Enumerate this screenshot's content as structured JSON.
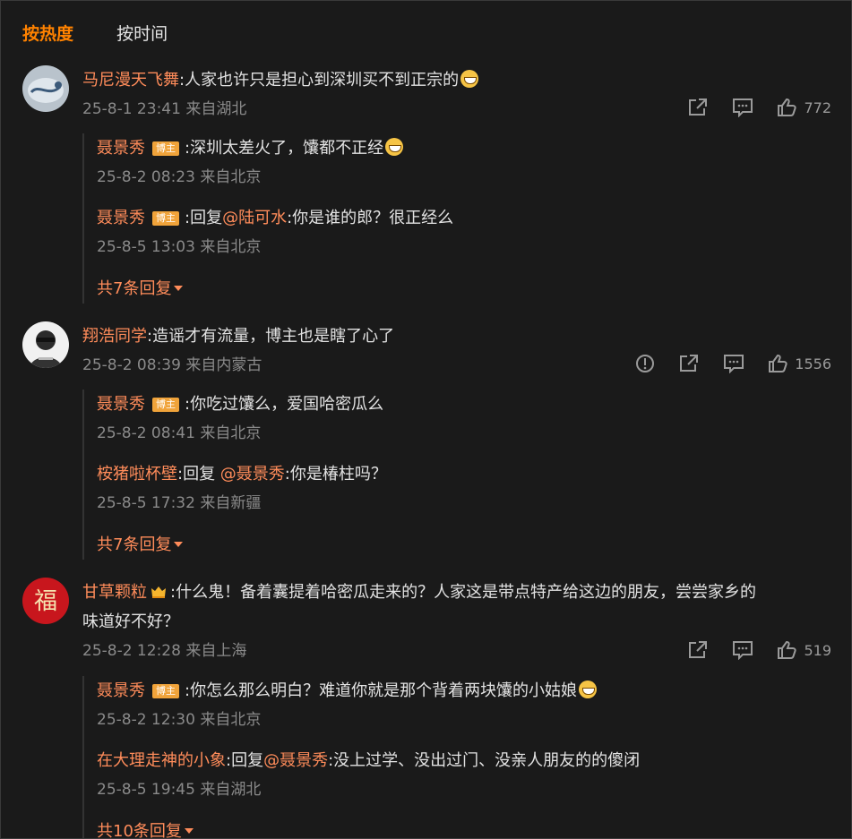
{
  "tabs": {
    "hot": "按热度",
    "time": "按时间"
  },
  "comments": [
    {
      "user": "马尼漫天飞舞",
      "text": ":人家也许只是担心到深圳买不到正宗的",
      "time": "25-8-1 23:41 来自湖北",
      "likes": "772",
      "replies": [
        {
          "user": "聂景秀",
          "badge": "博主",
          "text": ":深圳太差火了，馕都不正经",
          "time": "25-8-2 08:23 来自北京"
        },
        {
          "user": "聂景秀",
          "badge": "博主",
          "prefix": ":回复",
          "mention": "@陆可水",
          "text": ":你是谁的郎？很正经么",
          "time": "25-8-5 13:03 来自北京"
        }
      ],
      "more": "共7条回复"
    },
    {
      "user": "翔浩同学",
      "text": ":造谣才有流量，博主也是瞎了心了",
      "time": "25-8-2 08:39 来自内蒙古",
      "likes": "1556",
      "replies": [
        {
          "user": "聂景秀",
          "badge": "博主",
          "text": ":你吃过馕么，爱国哈密瓜么",
          "time": "25-8-2 08:41 来自北京"
        },
        {
          "user": "桉猪啦杯壁",
          "prefix": ":回复 ",
          "mention": "@聂景秀",
          "text": ":你是椿柱吗？",
          "time": "25-8-5 17:32 来自新疆"
        }
      ],
      "more": "共7条回复"
    },
    {
      "user": "甘草颗粒",
      "text_line1": ":什么鬼！备着囊提着哈密瓜走来的？人家这是带点特产给这边的朋友，尝尝家乡的",
      "text_line2": "味道好不好？",
      "time": "25-8-2 12:28 来自上海",
      "likes": "519",
      "avatar_char": "福",
      "replies": [
        {
          "user": "聂景秀",
          "badge": "博主",
          "text": ":你怎么那么明白？难道你就是那个背着两块馕的小姑娘",
          "time": "25-8-2 12:30 来自北京"
        },
        {
          "user": "在大理走神的小象",
          "prefix": ":回复",
          "mention": "@聂景秀",
          "text": ":没上过学、没出过门、没亲人朋友的的傻闭",
          "time": "25-8-5 19:45 来自湖北"
        }
      ],
      "more": "共10条回复"
    }
  ],
  "icons": [
    "share-icon",
    "comment-icon",
    "like-icon",
    "report-icon"
  ],
  "colors": {
    "accent": "#ff8200",
    "username": "#ff8c5a",
    "background": "#1a1a1a",
    "badge": "#f0a33a"
  }
}
